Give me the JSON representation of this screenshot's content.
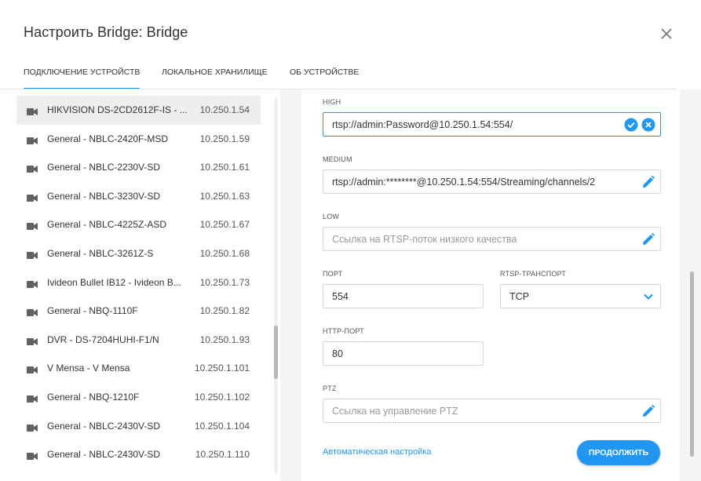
{
  "dialog": {
    "title": "Настроить Bridge: Bridge"
  },
  "tabs": [
    {
      "label": "ПОДКЛЮЧЕНИЕ УСТРОЙСТВ",
      "active": true
    },
    {
      "label": "ЛОКАЛЬНОЕ ХРАНИЛИЩЕ",
      "active": false
    },
    {
      "label": "ОБ УСТРОЙСТВЕ",
      "active": false
    }
  ],
  "devices": [
    {
      "name": "HIKVISION DS-2CD2612F-IS - ...",
      "ip": "10.250.1.54",
      "selected": true
    },
    {
      "name": "General - NBLC-2420F-MSD",
      "ip": "10.250.1.59"
    },
    {
      "name": "General - NBLC-2230V-SD",
      "ip": "10.250.1.61"
    },
    {
      "name": "General - NBLC-3230V-SD",
      "ip": "10.250.1.63"
    },
    {
      "name": "General - NBLC-4225Z-ASD",
      "ip": "10.250.1.67"
    },
    {
      "name": "General - NBLC-3261Z-S",
      "ip": "10.250.1.68"
    },
    {
      "name": "Ivideon Bullet IB12 - Ivideon B...",
      "ip": "10.250.1.73"
    },
    {
      "name": "General - NBQ-1110F",
      "ip": "10.250.1.82"
    },
    {
      "name": "DVR - DS-7204HUHI-F1/N",
      "ip": "10.250.1.93"
    },
    {
      "name": "V Mensa - V Mensa",
      "ip": "10.250.1.101"
    },
    {
      "name": "General - NBQ-1210F",
      "ip": "10.250.1.102"
    },
    {
      "name": "General - NBLC-2430V-SD",
      "ip": "10.250.1.104"
    },
    {
      "name": "General - NBLC-2430V-SD",
      "ip": "10.250.1.110"
    }
  ],
  "form": {
    "high": {
      "label": "HIGH",
      "value": "rtsp://admin:Password@10.250.1.54:554/"
    },
    "medium": {
      "label": "MEDIUM",
      "value": "rtsp://admin:********@10.250.1.54:554/Streaming/channels/2"
    },
    "low": {
      "label": "LOW",
      "placeholder": "Ссылка на RTSP-поток низкого качества"
    },
    "port": {
      "label": "ПОРТ",
      "value": "554"
    },
    "rtsp_transport": {
      "label": "RTSP-ТРАНСПОРТ",
      "value": "TCP"
    },
    "http_port": {
      "label": "HTTP-ПОРТ",
      "value": "80"
    },
    "ptz": {
      "label": "PTZ",
      "placeholder": "Ссылка на управление PTZ"
    },
    "auto_link": "Автоматическая настройка",
    "continue_button": "ПРОДОЛЖИТЬ"
  },
  "icons": {
    "close": "close-icon",
    "camera": "camera-icon",
    "confirm": "check-circle-icon",
    "clear": "clear-circle-icon",
    "edit": "pencil-icon",
    "dropdown": "chevron-down-icon"
  },
  "colors": {
    "accent": "#2196f3",
    "selected_row": "#eeeeee"
  }
}
